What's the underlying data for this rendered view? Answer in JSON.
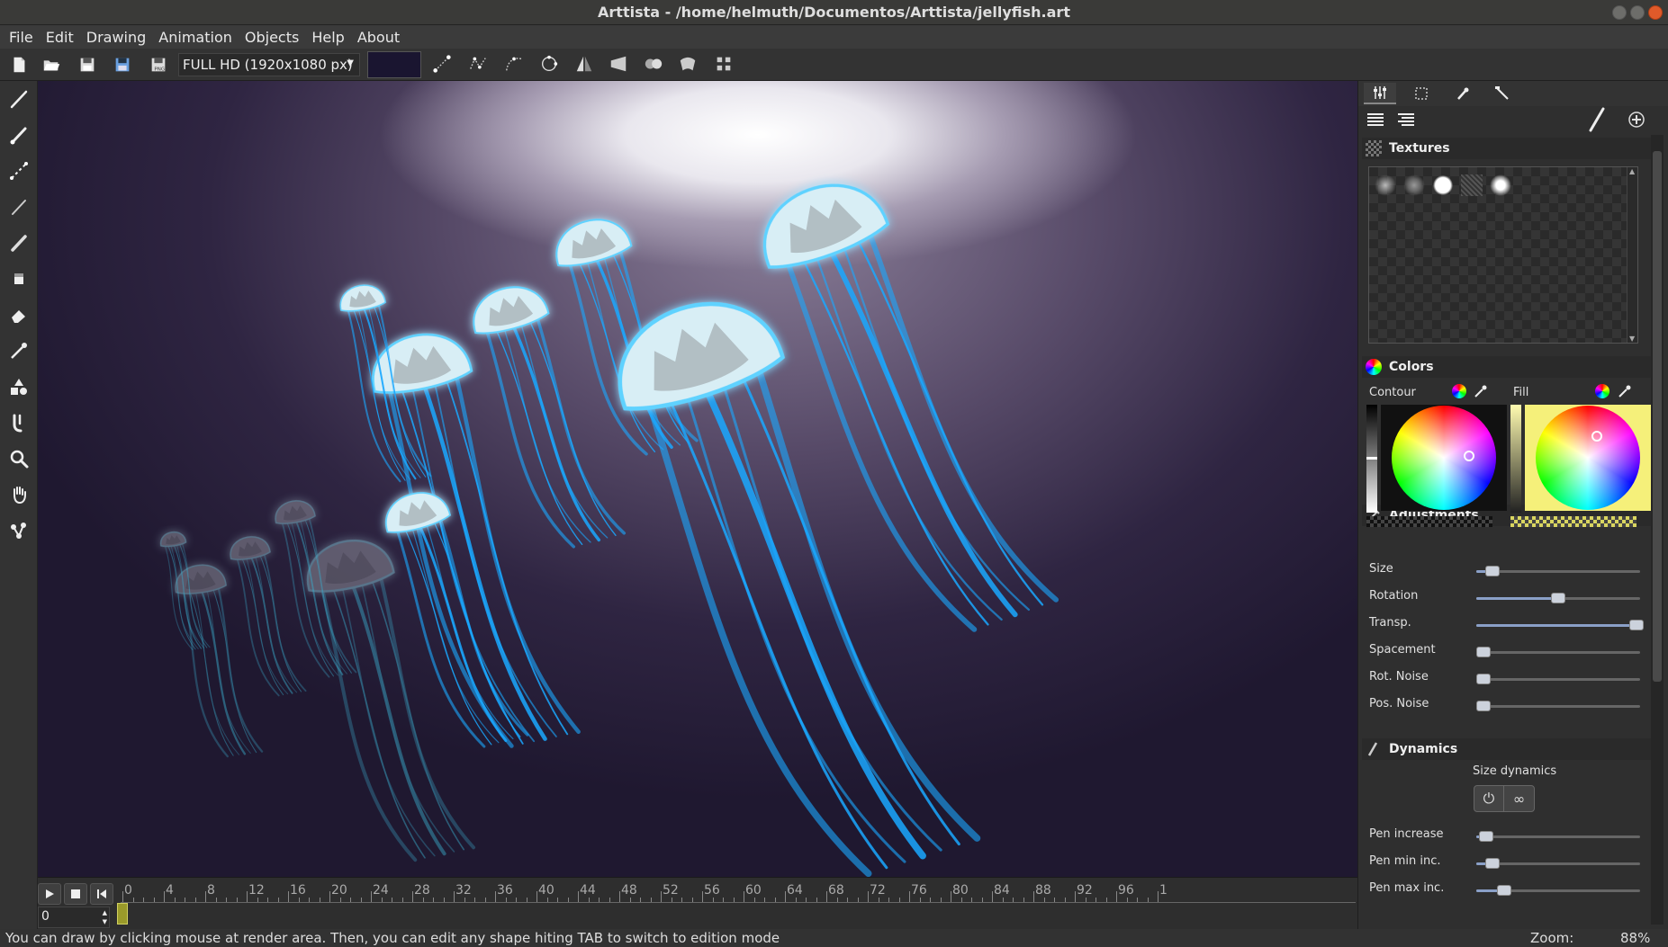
{
  "window": {
    "title": "Arttista - /home/helmuth/Documentos/Arttista/jellyfish.art"
  },
  "menu": {
    "items": [
      {
        "label": "File",
        "mnemonic": "F"
      },
      {
        "label": "Edit",
        "mnemonic": "E"
      },
      {
        "label": "Drawing",
        "mnemonic": "D"
      },
      {
        "label": "Animation",
        "mnemonic": "A"
      },
      {
        "label": "Objects",
        "mnemonic": "O"
      },
      {
        "label": "Help",
        "mnemonic": "H"
      },
      {
        "label": "About",
        "mnemonic": "A"
      }
    ]
  },
  "toolbar": {
    "resolution": "FULL HD (1920x1080 px)",
    "background_color": "#1a1530"
  },
  "canvas": {
    "background_top": "#ffffff",
    "background_bottom": "#1f1830",
    "jellyfish_body": "#d8eef5",
    "jellyfish_tentacle": "#1aa8ff"
  },
  "timeline": {
    "frame": "0",
    "ruler_labels": [
      "0",
      "4",
      "8",
      "12",
      "16",
      "20",
      "24",
      "28",
      "32",
      "36",
      "40",
      "44",
      "48",
      "52",
      "56",
      "60",
      "64",
      "68",
      "72",
      "76",
      "80",
      "84",
      "88",
      "92",
      "96",
      "1"
    ]
  },
  "status": {
    "message": "You can draw by clicking mouse at render area. Then, you can edit any shape hiting TAB to switch to edition mode",
    "zoom_label": "Zoom:",
    "zoom_value": "88%"
  },
  "panel": {
    "textures": {
      "title": "Textures"
    },
    "colors": {
      "title": "Colors",
      "contour_label": "Contour",
      "fill_label": "Fill",
      "contour_bg": "#111111",
      "fill_bg": "#f5f07a"
    },
    "adjustments": {
      "title": "Adjustments",
      "sliders": [
        {
          "label": "Size",
          "value": 0.1
        },
        {
          "label": "Rotation",
          "value": 0.5
        },
        {
          "label": "Transp.",
          "value": 0.98
        },
        {
          "label": "Spacement",
          "value": 0.04
        },
        {
          "label": "Rot. Noise",
          "value": 0.04
        },
        {
          "label": "Pos. Noise",
          "value": 0.04
        }
      ]
    },
    "dynamics": {
      "title": "Dynamics",
      "size_dynamics_label": "Size dynamics",
      "button_off": "⏻",
      "button_loop": "∞",
      "sliders": [
        {
          "label": "Pen increase",
          "value": 0.06
        },
        {
          "label": "Pen min inc.",
          "value": 0.1
        },
        {
          "label": "Pen max inc.",
          "value": 0.17
        }
      ]
    }
  }
}
